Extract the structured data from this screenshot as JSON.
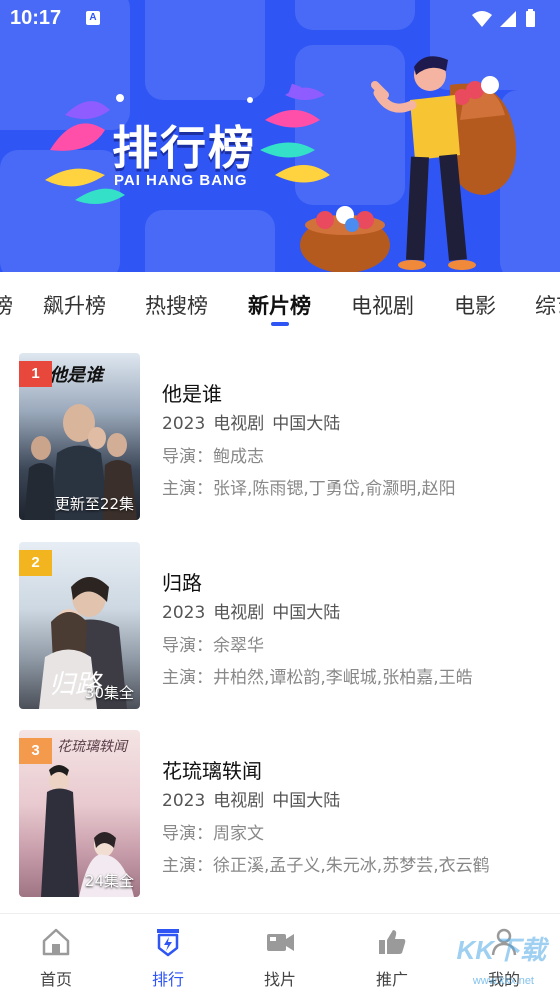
{
  "status_bar": {
    "time": "10:17",
    "notification_letter": "A"
  },
  "banner": {
    "title": "排行榜",
    "subtitle": "PAI HANG BANG"
  },
  "tabs": [
    {
      "label": "榜",
      "active": false
    },
    {
      "label": "飙升榜",
      "active": false
    },
    {
      "label": "热搜榜",
      "active": false
    },
    {
      "label": "新片榜",
      "active": true
    },
    {
      "label": "电视剧",
      "active": false
    },
    {
      "label": "电影",
      "active": false
    },
    {
      "label": "综艺",
      "active": false
    }
  ],
  "items": [
    {
      "rank": "1",
      "rank_color": "#e8473c",
      "episodes": "更新至22集",
      "poster_text": "他是谁",
      "title": "他是谁",
      "year": "2023",
      "genre": "电视剧",
      "region": "中国大陆",
      "director": "导演：鲍成志",
      "cast": "主演：张译,陈雨锶,丁勇岱,俞灏明,赵阳"
    },
    {
      "rank": "2",
      "rank_color": "#f2b520",
      "episodes": "30集全",
      "poster_text": "归路",
      "title": "归路",
      "year": "2023",
      "genre": "电视剧",
      "region": "中国大陆",
      "director": "导演：余翠华",
      "cast": "主演：井柏然,谭松韵,李岷城,张柏嘉,王皓"
    },
    {
      "rank": "3",
      "rank_color": "#f39a4d",
      "episodes": "24集全",
      "poster_text": "花琉璃轶闻",
      "title": "花琉璃轶闻",
      "year": "2023",
      "genre": "电视剧",
      "region": "中国大陆",
      "director": "导演：周家文",
      "cast": "主演：徐正溪,孟子义,朱元冰,苏梦芸,衣云鹤"
    }
  ],
  "bottom_nav": [
    {
      "label": "首页",
      "icon": "home-icon",
      "active": false
    },
    {
      "label": "排行",
      "icon": "ranking-icon",
      "active": true
    },
    {
      "label": "找片",
      "icon": "video-camera-icon",
      "active": false
    },
    {
      "label": "推广",
      "icon": "thumbs-up-icon",
      "active": false
    },
    {
      "label": "我的",
      "icon": "profile-icon",
      "active": false
    }
  ],
  "watermark": {
    "text": "KK下载",
    "url": "www.kkx.net"
  },
  "colors": {
    "accent": "#2f56f5",
    "banner_bg": "#2f56f5"
  }
}
